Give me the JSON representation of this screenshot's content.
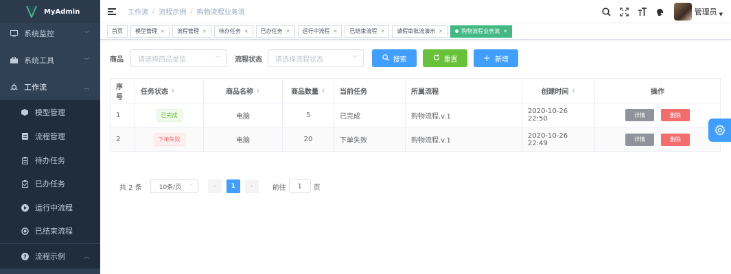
{
  "app": {
    "logo_text": "MyAdmin"
  },
  "sidebar": {
    "items": [
      {
        "label": "系统监控",
        "icon": "monitor-icon"
      },
      {
        "label": "系统工具",
        "icon": "toolbox-icon"
      },
      {
        "label": "工作流",
        "icon": "workflow-icon"
      },
      {
        "label": "模型管理",
        "icon": "cube-icon"
      },
      {
        "label": "流程管理",
        "icon": "document-icon"
      },
      {
        "label": "待办任务",
        "icon": "clipboard-icon"
      },
      {
        "label": "已办任务",
        "icon": "clipboard-check-icon"
      },
      {
        "label": "运行中流程",
        "icon": "play-circle-icon"
      },
      {
        "label": "已结束流程",
        "icon": "stop-circle-icon"
      },
      {
        "label": "流程示例",
        "icon": "question-circle-icon"
      }
    ]
  },
  "breadcrumb": [
    "工作流",
    "流程示例",
    "购物流程业务流"
  ],
  "header": {
    "user_name": "管理员"
  },
  "tags": [
    {
      "label": "首页",
      "closable": false,
      "active": false
    },
    {
      "label": "模型管理",
      "closable": true,
      "active": false
    },
    {
      "label": "流程管理",
      "closable": true,
      "active": false
    },
    {
      "label": "待办任务",
      "closable": true,
      "active": false
    },
    {
      "label": "已办任务",
      "closable": true,
      "active": false
    },
    {
      "label": "运行中流程",
      "closable": true,
      "active": false
    },
    {
      "label": "已结束流程",
      "closable": true,
      "active": false
    },
    {
      "label": "请假审批流演示",
      "closable": true,
      "active": false
    },
    {
      "label": "购物流程业务流",
      "closable": true,
      "active": true
    }
  ],
  "search": {
    "product_label": "商品",
    "product_placeholder": "请选择商品类型",
    "status_label": "流程状态",
    "status_placeholder": "请选择流程状态",
    "search_btn": "搜索",
    "reset_btn": "重置",
    "add_btn": "新增"
  },
  "table": {
    "headers": [
      "序号",
      "任务状态",
      "商品名称",
      "商品数量",
      "当前任务",
      "所属流程",
      "创建时间",
      "操作"
    ],
    "rows": [
      {
        "index": "1",
        "status": "已完成",
        "product": "电脑",
        "qty": "5",
        "task": "已完成",
        "process": "购物流程.v.1",
        "created": "2020-10-26 22:50",
        "detail": "详情",
        "delete": "删除"
      },
      {
        "index": "2",
        "status": "下单失败",
        "product": "电脑",
        "qty": "20",
        "task": "下单失败",
        "process": "购物流程.v.1",
        "created": "2020-10-26 22:49",
        "detail": "详情",
        "delete": "删除"
      }
    ]
  },
  "pagination": {
    "total": "共 2 条",
    "page_size": "10条/页",
    "current_page": "1",
    "goto_label": "前往",
    "goto_value": "1",
    "page_suffix": "页"
  },
  "colors": {
    "sidebar_bg": "#304156",
    "primary": "#409eff",
    "success": "#67c23a",
    "active_tag": "#42b983",
    "danger": "#f56c6c",
    "info": "#909399"
  }
}
